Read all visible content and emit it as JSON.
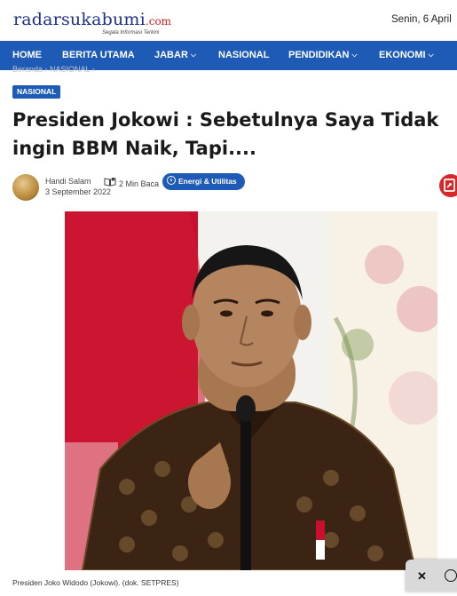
{
  "site": {
    "logo_main": "radarsukabumi",
    "logo_domain": ".com",
    "tagline": "Segala Informasi Terkini",
    "date": "Senin, 6 April"
  },
  "nav": {
    "items": [
      {
        "label": "HOME"
      },
      {
        "label": "BERITA UTAMA"
      },
      {
        "label": "JABAR",
        "dropdown": true
      },
      {
        "label": "NASIONAL"
      },
      {
        "label": "PENDIDIKAN",
        "dropdown": true
      },
      {
        "label": "EKONOMI",
        "dropdown": true
      }
    ]
  },
  "breadcrumb": {
    "home": "Beranda",
    "category": "NASIONAL"
  },
  "article": {
    "category_badge": "NASIONAL",
    "title_line1": "Presiden Jokowi : Sebetulnya Saya Tidak",
    "title_line2": "ingin BBM Naik, Tapi....",
    "author": "Handi Salam",
    "date": "3 September 2022",
    "read_time": "2 Min Baca",
    "topic": "Energi & Utilitas",
    "caption": "Presiden Joko Widodo (Jokowi). (dok. SETPRES)"
  },
  "colors": {
    "brand": "#1e5bb7",
    "logo_blue": "#1e2f8c",
    "accent_red": "#d62828"
  },
  "icons": {
    "read": "book-open-icon",
    "topic": "arrow-up-circle-icon",
    "share": "share-icon",
    "close": "close-icon",
    "ad": "arrow-circle-icon"
  }
}
